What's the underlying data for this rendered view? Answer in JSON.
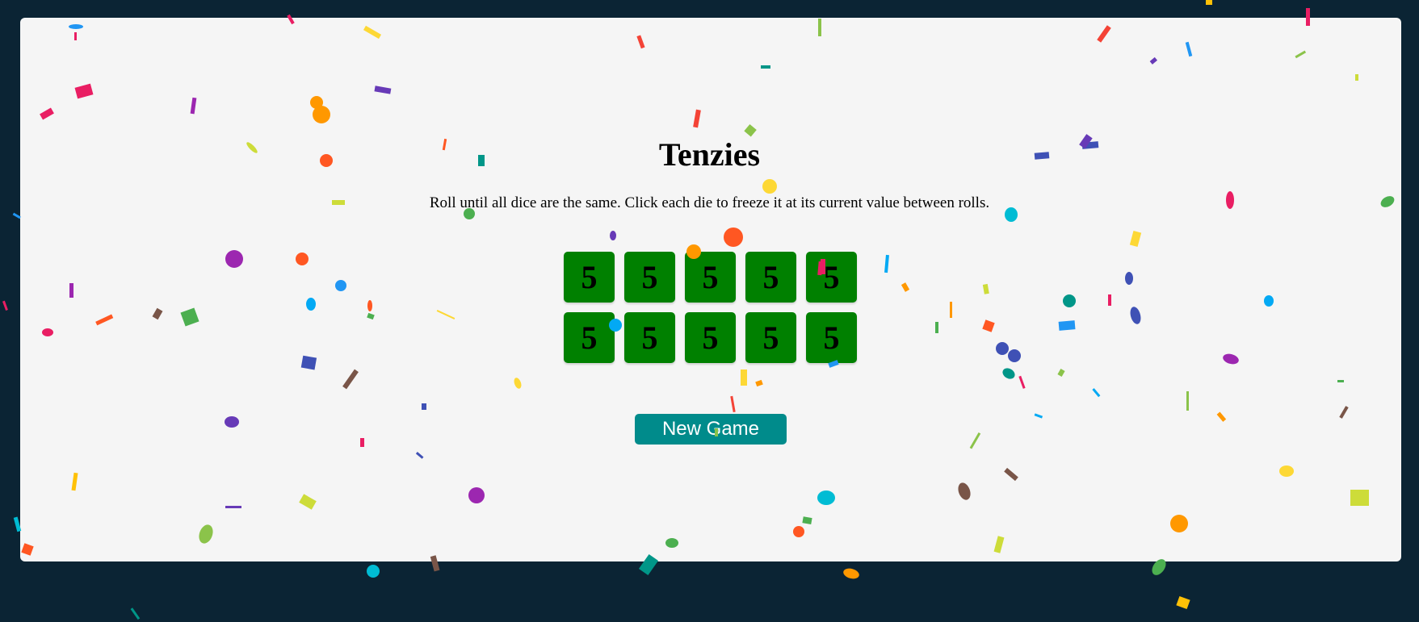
{
  "game": {
    "title": "Tenzies",
    "instructions": "Roll until all dice are the same. Click each die to freeze it at its current value between rolls.",
    "button_label": "New Game"
  },
  "dice": [
    {
      "value": "5",
      "held": true
    },
    {
      "value": "5",
      "held": true
    },
    {
      "value": "5",
      "held": true
    },
    {
      "value": "5",
      "held": true
    },
    {
      "value": "5",
      "held": true
    },
    {
      "value": "5",
      "held": true
    },
    {
      "value": "5",
      "held": true
    },
    {
      "value": "5",
      "held": true
    },
    {
      "value": "5",
      "held": true
    },
    {
      "value": "5",
      "held": true
    }
  ],
  "colors": {
    "background": "#0b2434",
    "board": "#f5f5f5",
    "held_die": "#008000",
    "button": "#008b8b"
  }
}
